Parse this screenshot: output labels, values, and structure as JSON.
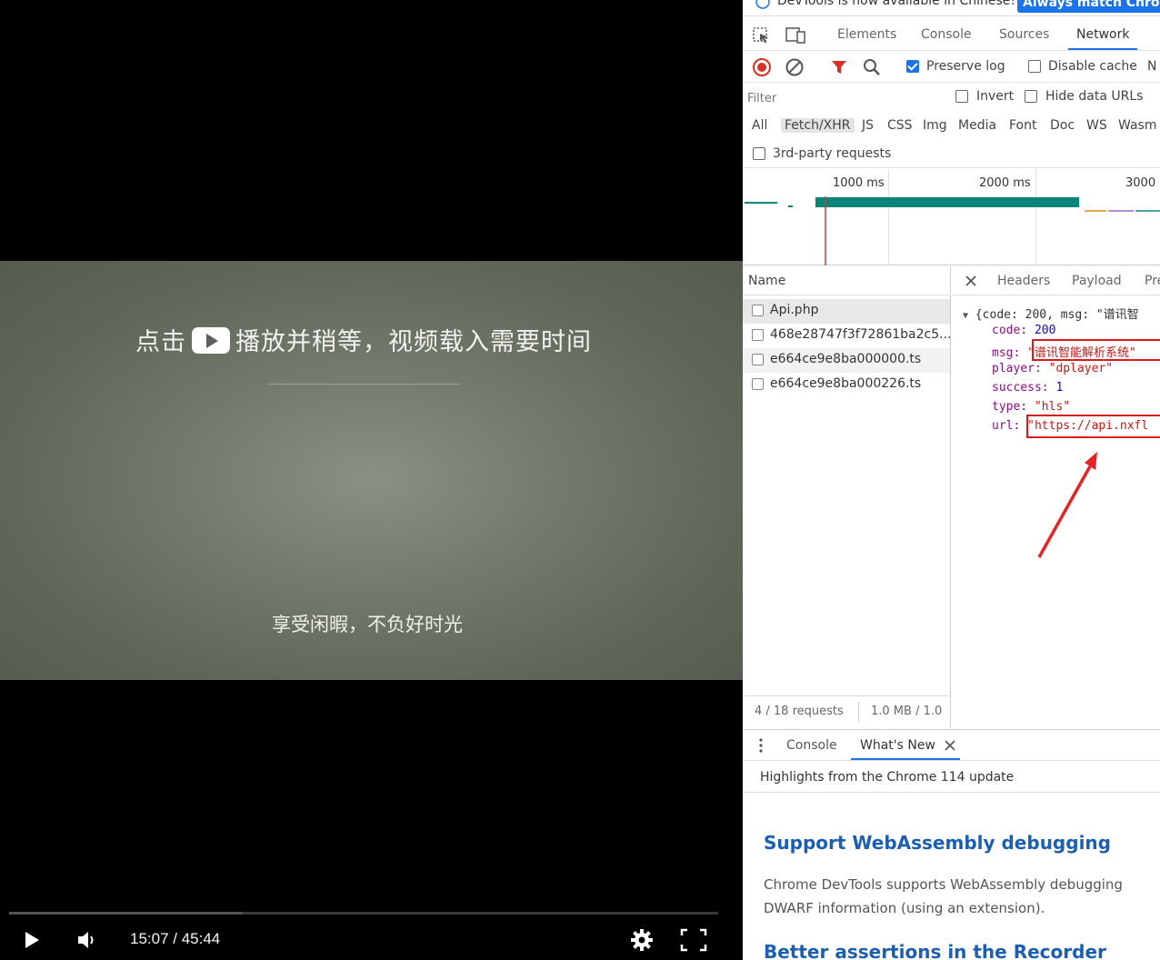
{
  "player": {
    "hint_before": "点击",
    "hint_after": "播放并稍等，视频载入需要时间",
    "slogan": "享受闲暇，不负好时光",
    "time": "15:07 / 45:44",
    "progress": 0.33
  },
  "devtools": {
    "infobar": {
      "text": "DevTools is now available in Chinese!",
      "button": "Always match Chrome"
    },
    "tabs": [
      "Elements",
      "Console",
      "Sources",
      "Network"
    ],
    "active_tab": "Network",
    "toolbar": {
      "preserve_log": "Preserve log",
      "disable_cache": "Disable cache",
      "throttle_partial": "N"
    },
    "filter": {
      "placeholder": "Filter",
      "invert": "Invert",
      "hide_data_urls": "Hide data URLs"
    },
    "types": [
      "All",
      "Fetch/XHR",
      "JS",
      "CSS",
      "Img",
      "Media",
      "Font",
      "Doc",
      "WS",
      "Wasm"
    ],
    "active_type": "Fetch/XHR",
    "third_party": "3rd-party requests",
    "timeline_ticks": [
      "1000 ms",
      "2000 ms",
      "3000"
    ],
    "name_header": "Name",
    "requests": [
      "Api.php",
      "468e28747f3f72861ba2c5...",
      "e664ce9e8ba000000.ts",
      "e664ce9e8ba000226.ts"
    ],
    "summary": {
      "requests": "4 / 18 requests",
      "size": "1.0 MB / 1.0"
    },
    "detail_tabs": [
      "Headers",
      "Payload",
      "Pre"
    ],
    "json_preview": {
      "summary_line": "{code: 200, msg: \"谱讯智",
      "code_key": "code:",
      "code_val": "200",
      "msg_key": "msg:",
      "msg_val": "\"谱讯智能解析系统\"",
      "player_key": "player:",
      "player_val": "\"dplayer\"",
      "success_key": "success:",
      "success_val": "1",
      "type_key": "type:",
      "type_val": "\"hls\"",
      "url_key": "url:",
      "url_val": "\"https://api.nxfl"
    },
    "drawer": {
      "tabs": [
        "Console",
        "What's New"
      ],
      "highlights": "Highlights from the Chrome 114 update",
      "feature1_title": "Support WebAssembly debugging",
      "feature1_body_line1": "Chrome DevTools supports WebAssembly debugging",
      "feature1_body_line2": "DWARF information (using an extension).",
      "feature2_title": "Better assertions in the Recorder"
    }
  },
  "colors": {
    "accent": "#1a73e8",
    "record_red": "#d93025",
    "annotation_red": "#d81b1b",
    "timeline_teal": "#0b8577"
  }
}
